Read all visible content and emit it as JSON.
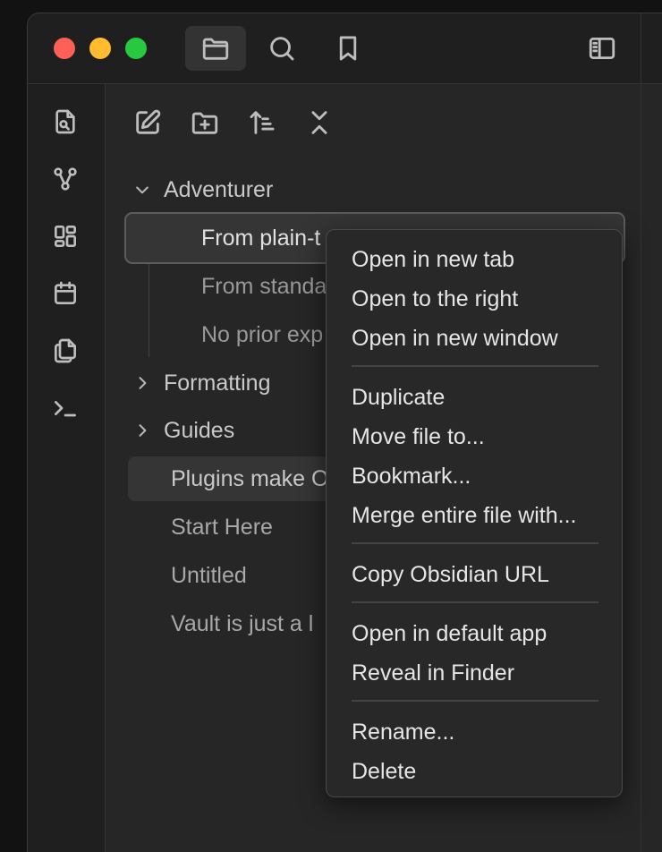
{
  "toolbar": {
    "tabs": [
      {
        "name": "files",
        "icon": "folder-icon",
        "active": true
      },
      {
        "name": "search",
        "icon": "search-icon",
        "active": false
      },
      {
        "name": "bookmarks",
        "icon": "bookmark-icon",
        "active": false
      }
    ],
    "right_icon": "sidebar-toggle-icon"
  },
  "ribbon": {
    "icons": [
      "open-quick-switcher-icon",
      "graph-view-icon",
      "canvas-icon",
      "daily-note-calendar-icon",
      "templates-copy-icon",
      "command-palette-terminal-icon"
    ]
  },
  "file_nav": {
    "actions": [
      "new-note-icon",
      "new-folder-icon",
      "sort-icon",
      "collapse-all-icon"
    ]
  },
  "tree": {
    "folder_adventurer": "Adventurer",
    "children": [
      "From plain-t",
      "From standa",
      "No prior exp"
    ],
    "folder_formatting": "Formatting",
    "folder_guides": "Guides",
    "files": [
      "Plugins make O",
      "Start Here",
      "Untitled",
      "Vault is just a l"
    ]
  },
  "context_menu": {
    "groups": [
      [
        "Open in new tab",
        "Open to the right",
        "Open in new window"
      ],
      [
        "Duplicate",
        "Move file to...",
        "Bookmark...",
        "Merge entire file with..."
      ],
      [
        "Copy Obsidian URL"
      ],
      [
        "Open in default app",
        "Reveal in Finder"
      ],
      [
        "Rename...",
        "Delete"
      ]
    ]
  },
  "colors": {
    "traffic_red": "#fe5f57",
    "traffic_yellow": "#febc2e",
    "traffic_green": "#28c840",
    "background": "#262626",
    "menu_background": "#282828"
  }
}
